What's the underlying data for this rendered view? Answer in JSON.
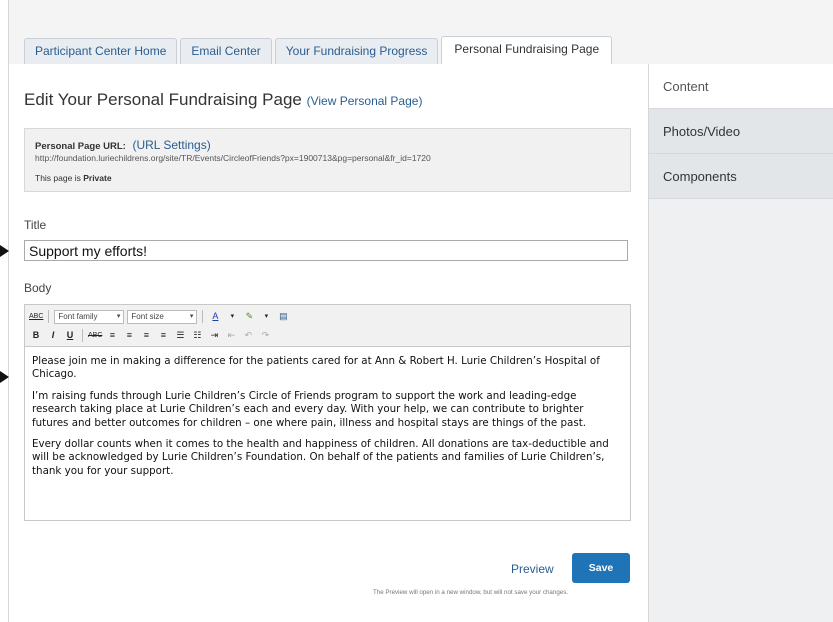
{
  "tabs": [
    {
      "label": "Participant Center Home"
    },
    {
      "label": "Email Center"
    },
    {
      "label": "Your Fundraising Progress"
    },
    {
      "label": "Personal Fundraising Page"
    }
  ],
  "sidebar": {
    "items": [
      {
        "label": "Content"
      },
      {
        "label": "Photos/Video"
      },
      {
        "label": "Components"
      }
    ]
  },
  "page": {
    "title": "Edit Your Personal Fundraising Page",
    "view_link": "(View Personal Page)"
  },
  "url_box": {
    "label": "Personal Page URL:",
    "settings_link": "(URL Settings)",
    "url": "http://foundation.luriechildrens.org/site/TR/Events/CircleofFriends?px=1900713&pg=personal&fr_id=1720",
    "privacy_prefix": "This page is",
    "privacy_status": "Private"
  },
  "form": {
    "title_label": "Title",
    "title_value": "Support my efforts!",
    "body_label": "Body"
  },
  "toolbar": {
    "font_family": "Font family",
    "font_size": "Font size",
    "spell_label": "ABC",
    "bold": "B",
    "italic": "I",
    "underline": "U",
    "strike": "ABC",
    "text_color": "A"
  },
  "body_text": {
    "p1": "Please join me in making a difference for the patients cared for at Ann & Robert H. Lurie Children’s Hospital of Chicago.",
    "p2": "I’m raising funds through Lurie Children’s Circle of Friends program to support the work and leading-edge research taking place at Lurie Children’s each and every day. With your help, we can contribute to brighter futures and better outcomes for children – one where pain, illness and hospital stays are things of the past.",
    "p3": "Every dollar counts when it comes to the health and happiness of children.  All donations are tax-deductible and will be acknowledged by Lurie Children’s Foundation. On behalf of the patients and families of Lurie Children’s, thank you for your support."
  },
  "actions": {
    "preview": "Preview",
    "save": "Save",
    "note": "The Preview will open in a new window, but will not save your changes."
  },
  "colors": {
    "link": "#2a5d8f",
    "save_button": "#1f73b7"
  }
}
